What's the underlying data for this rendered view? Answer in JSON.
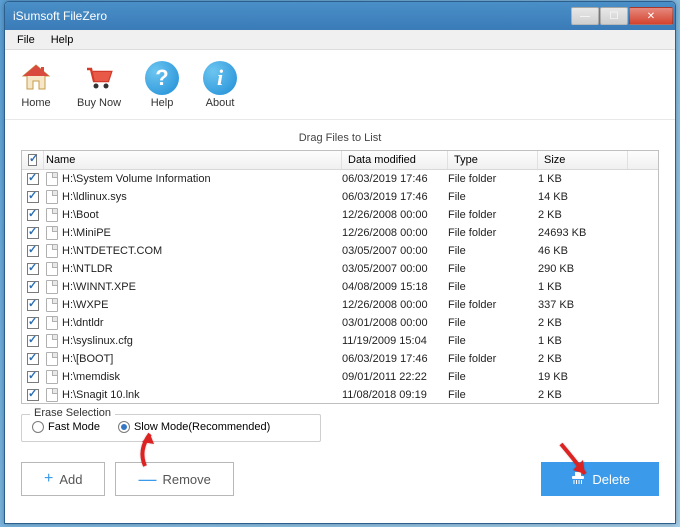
{
  "window": {
    "title": "iSumsoft FileZero"
  },
  "menubar": {
    "file": "File",
    "help": "Help"
  },
  "toolbar": {
    "home": "Home",
    "buynow": "Buy Now",
    "help": "Help",
    "about": "About"
  },
  "drag_label": "Drag Files to List",
  "columns": {
    "name": "Name",
    "date": "Data modified",
    "type": "Type",
    "size": "Size"
  },
  "rows": [
    {
      "name": "H:\\System Volume Information",
      "date": "06/03/2019 17:46",
      "type": "File folder",
      "size": "1 KB"
    },
    {
      "name": "H:\\ldlinux.sys",
      "date": "06/03/2019 17:46",
      "type": "File",
      "size": "14 KB"
    },
    {
      "name": "H:\\Boot",
      "date": "12/26/2008 00:00",
      "type": "File folder",
      "size": "2 KB"
    },
    {
      "name": "H:\\MiniPE",
      "date": "12/26/2008 00:00",
      "type": "File folder",
      "size": "24693 KB"
    },
    {
      "name": "H:\\NTDETECT.COM",
      "date": "03/05/2007 00:00",
      "type": "File",
      "size": "46 KB"
    },
    {
      "name": "H:\\NTLDR",
      "date": "03/05/2007 00:00",
      "type": "File",
      "size": "290 KB"
    },
    {
      "name": "H:\\WINNT.XPE",
      "date": "04/08/2009 15:18",
      "type": "File",
      "size": "1 KB"
    },
    {
      "name": "H:\\WXPE",
      "date": "12/26/2008 00:00",
      "type": "File folder",
      "size": "337 KB"
    },
    {
      "name": "H:\\dntldr",
      "date": "03/01/2008 00:00",
      "type": "File",
      "size": "2 KB"
    },
    {
      "name": "H:\\syslinux.cfg",
      "date": "11/19/2009 15:04",
      "type": "File",
      "size": "1 KB"
    },
    {
      "name": "H:\\[BOOT]",
      "date": "06/03/2019 17:46",
      "type": "File folder",
      "size": "2 KB"
    },
    {
      "name": "H:\\memdisk",
      "date": "09/01/2011 22:22",
      "type": "File",
      "size": "19 KB"
    },
    {
      "name": "H:\\Snagit 10.lnk",
      "date": "11/08/2018 09:19",
      "type": "File",
      "size": "2 KB"
    }
  ],
  "erase": {
    "legend": "Erase Selection",
    "fast": "Fast Mode",
    "slow": "Slow Mode(Recommended)",
    "selected": "slow"
  },
  "buttons": {
    "add": "Add",
    "remove": "Remove",
    "delete": "Delete"
  }
}
